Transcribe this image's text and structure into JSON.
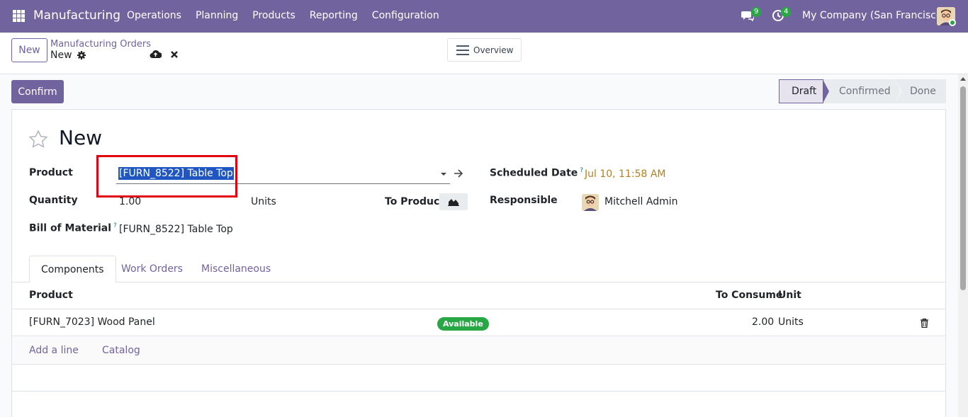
{
  "navbar": {
    "app_name": "Manufacturing",
    "menu": [
      "Operations",
      "Planning",
      "Products",
      "Reporting",
      "Configuration"
    ],
    "messages_count": "9",
    "activities_count": "4",
    "company": "My Company (San Francisco)"
  },
  "control_panel": {
    "new_label": "New",
    "breadcrumb_parent": "Manufacturing Orders",
    "breadcrumb_current": "New",
    "overview_label": "Overview"
  },
  "actions": {
    "confirm_label": "Confirm"
  },
  "statusbar": {
    "stages": [
      "Draft",
      "Confirmed",
      "Done"
    ],
    "active": "Draft"
  },
  "form": {
    "title": "New",
    "product_label": "Product",
    "product_value": "[FURN_8522] Table Top",
    "quantity_label": "Quantity",
    "quantity_value": "1.00",
    "uom_value": "Units",
    "to_produce_label": "To Produce",
    "bom_label": "Bill of Material",
    "bom_help": "?",
    "bom_value": "[FURN_8522] Table Top",
    "scheduled_label": "Scheduled Date",
    "scheduled_help": "?",
    "scheduled_value": "Jul 10, 11:58 AM",
    "responsible_label": "Responsible",
    "responsible_value": "Mitchell Admin"
  },
  "tabs": [
    "Components",
    "Work Orders",
    "Miscellaneous"
  ],
  "components_table": {
    "headers": {
      "product": "Product",
      "to_consume": "To Consume",
      "unit": "Unit"
    },
    "rows": [
      {
        "product": "[FURN_7023] Wood Panel",
        "status": "Available",
        "to_consume": "2.00",
        "unit": "Units"
      }
    ],
    "add_line": "Add a line",
    "catalog": "Catalog"
  },
  "colors": {
    "brand": "#71639e",
    "highlight": "#e3000f",
    "available": "#28a745",
    "date": "#b5801c"
  }
}
